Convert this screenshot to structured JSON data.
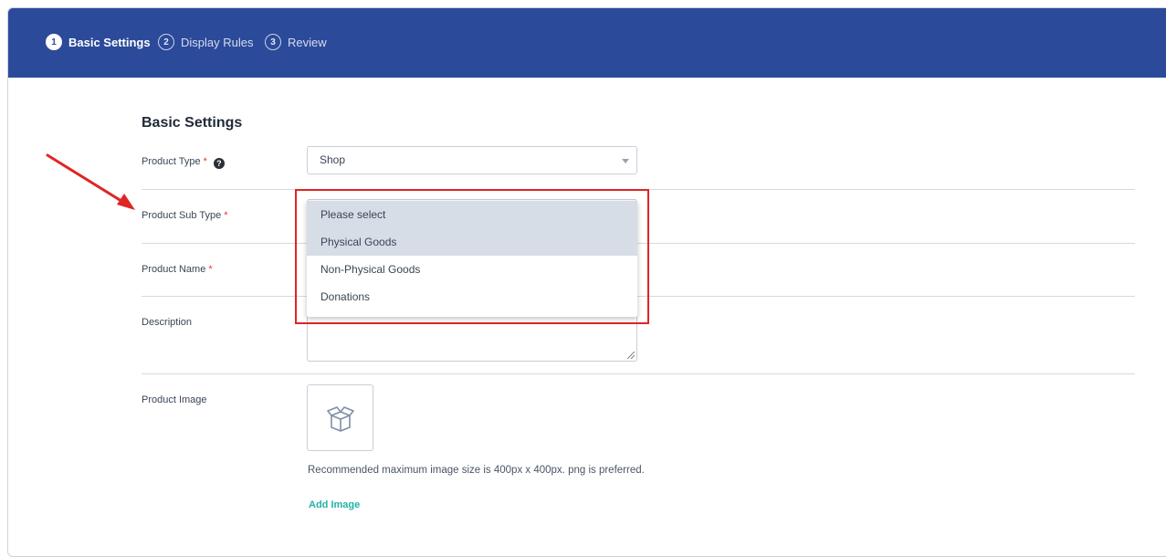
{
  "steps": [
    {
      "num": "1",
      "label": "Basic Settings",
      "active": true
    },
    {
      "num": "2",
      "label": "Display Rules",
      "active": false
    },
    {
      "num": "3",
      "label": "Review",
      "active": false
    }
  ],
  "section_title": "Basic Settings",
  "fields": {
    "product_type": {
      "label": "Product Type",
      "required": "*",
      "help_icon": "question-circle-icon",
      "value": "Shop"
    },
    "product_sub_type": {
      "label": "Product Sub Type",
      "required": "*"
    },
    "product_name": {
      "label": "Product Name",
      "required": "*"
    },
    "description": {
      "label": "Description"
    },
    "product_image": {
      "label": "Product Image",
      "placeholder_icon": "box-icon"
    }
  },
  "dropdown": {
    "options": [
      "Please select",
      "Physical Goods",
      "Non-Physical Goods",
      "Donations"
    ]
  },
  "image_hint": "Recommended maximum image size is 400px x 400px. png is preferred.",
  "add_image_label": "Add Image",
  "colors": {
    "header_bg": "#2c4a9a",
    "accent_link": "#20b3a6",
    "annotation_red": "#e02424",
    "required_star": "#e53935"
  }
}
